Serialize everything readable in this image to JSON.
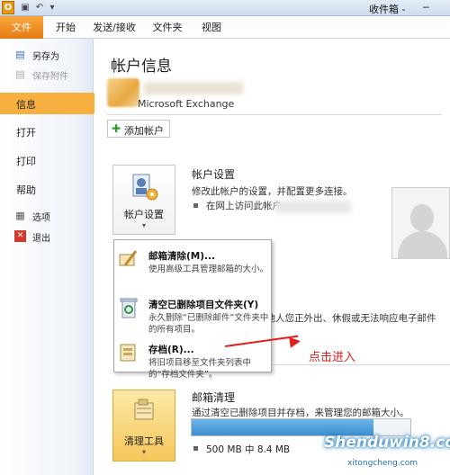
{
  "titlebar": {
    "title": "收件箱 -"
  },
  "tabs": [
    {
      "label": "文件"
    },
    {
      "label": "开始"
    },
    {
      "label": "发送/接收"
    },
    {
      "label": "文件夹"
    },
    {
      "label": "视图"
    }
  ],
  "leftnav": {
    "save_as": "另存为",
    "save_attachments": "保存附件",
    "info": "信息",
    "open": "打开",
    "print": "打印",
    "help": "帮助",
    "options": "选项",
    "exit": "退出"
  },
  "main": {
    "title": "帐户信息",
    "account_type": "Microsoft Exchange",
    "add_account": "添加帐户",
    "account_settings": {
      "button": "帐户设置",
      "title": "帐户设置",
      "desc": "修改此帐户的设置，并配置更多连接。",
      "sub": "在网上访问此帐户"
    },
    "ooo_text": "其他人您正外出、休假或无法响应电子邮件",
    "cleanup": {
      "button": "清理工具",
      "title": "邮箱清理",
      "desc": "通过清空已删除项目并存档，来管理您的邮箱大小。",
      "quota": "500 MB 中 8.4 MB",
      "used_fraction": 0.83
    }
  },
  "dropdown": [
    {
      "title": "邮箱清除(M)...",
      "desc": "使用高级工具管理邮箱的大小。"
    },
    {
      "title": "清空已删除项目文件夹(Y)",
      "desc": "永久删除“已删除邮件”文件夹中的所有项目。"
    },
    {
      "title": "存档(R)...",
      "desc": "将旧项目移至文件夹列表中的“存档文件夹”。"
    }
  ],
  "annotation": {
    "note": "点击进入"
  },
  "watermark": {
    "main": "Shenduwin8.com",
    "sub": "xitongcheng.com"
  }
}
